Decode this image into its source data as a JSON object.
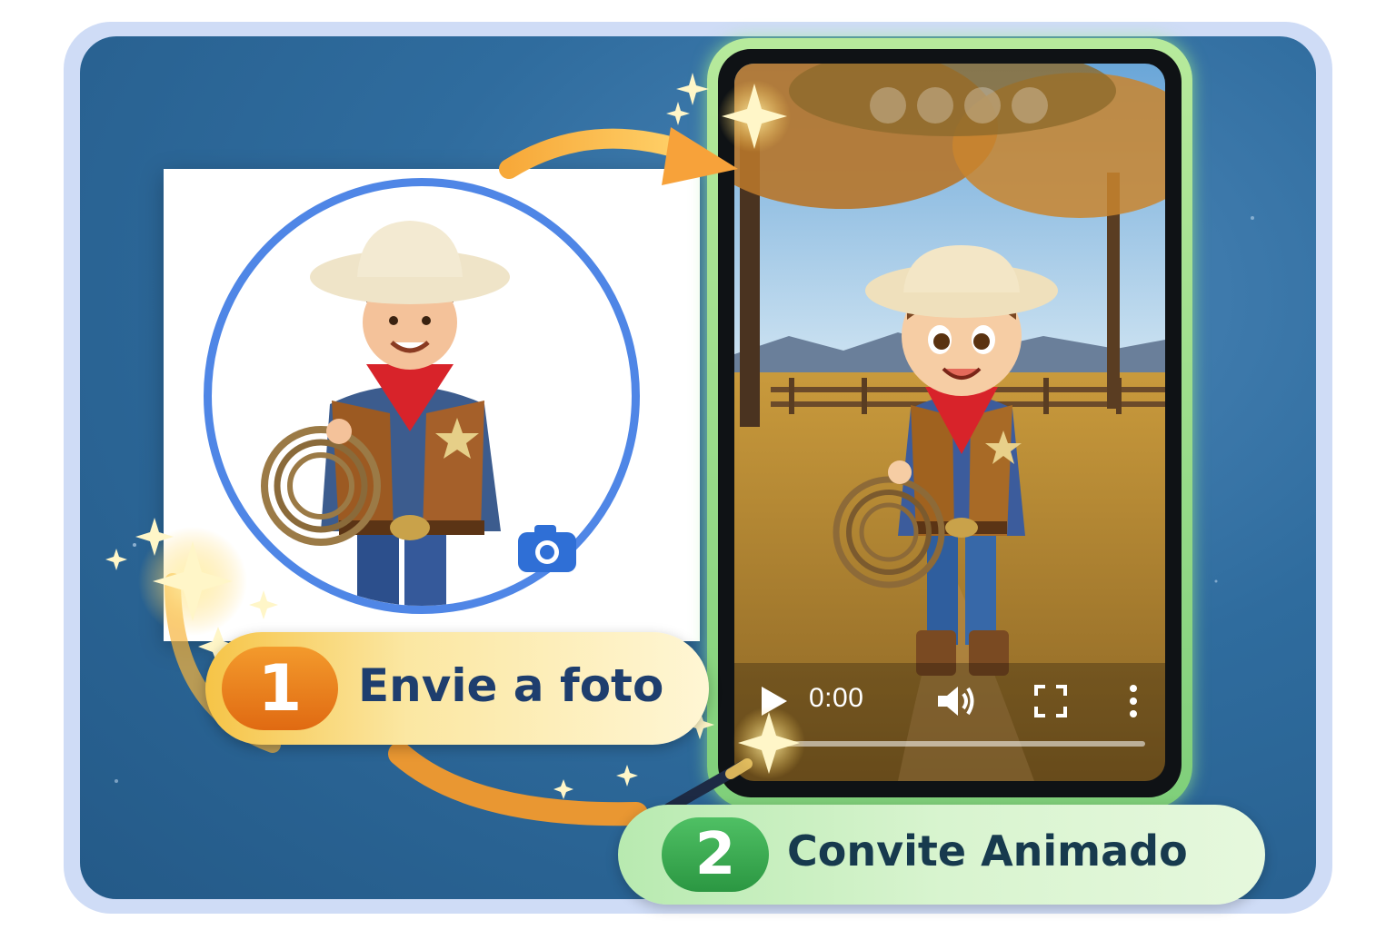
{
  "steps": [
    {
      "number": "1",
      "label": "Envie a foto"
    },
    {
      "number": "2",
      "label": "Convite Animado"
    }
  ],
  "video_player": {
    "time": "0:00",
    "progress": 0,
    "controls": [
      "play-icon",
      "volume-icon",
      "fullscreen-icon",
      "more-options-icon"
    ]
  },
  "icons": [
    "camera-icon",
    "sparkle-icon",
    "magic-wand-icon",
    "arrow-icon"
  ],
  "colors": {
    "background_blue": "#2f6c9e",
    "step1_badge": "#e97d1c",
    "step2_badge": "#3aab52",
    "circle_border": "#4f86e6",
    "phone_frame": "#8fd884",
    "label_text_dark": "#1e3e6e"
  }
}
